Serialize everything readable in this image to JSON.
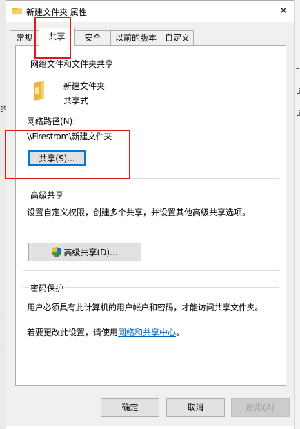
{
  "window": {
    "title": "新建文件夹 属性",
    "close_glyph": "✕"
  },
  "tabs": [
    {
      "label": "常规"
    },
    {
      "label": "共享",
      "active": true
    },
    {
      "label": "安全"
    },
    {
      "label": "以前的版本"
    },
    {
      "label": "自定义"
    }
  ],
  "network_share": {
    "group_title": "网络文件和文件夹共享",
    "folder_name": "新建文件夹",
    "share_state": "共享式",
    "path_label": "网络路径(N):",
    "path_value": "\\\\Firestrom\\新建文件夹",
    "share_button": "共享(S)..."
  },
  "advanced_share": {
    "group_title": "高级共享",
    "description": "设置自定义权限，创建多个共享，并设置其他高级共享选项。",
    "button": "高级共享(D)..."
  },
  "password": {
    "group_title": "密码保护",
    "description": "用户必须具有此计算机的用户帐户和密码，才能访问共享文件夹。",
    "change_prefix": "若要更改此设置，请使用",
    "link_text": "网络和共享中心",
    "change_suffix": "。"
  },
  "footer": {
    "ok": "确定",
    "cancel": "取消",
    "apply": "应用(A)"
  },
  "background": {
    "left_glyphs": [
      "的",
      "i",
      "i"
    ],
    "right_glyphs": [
      "t",
      "ti",
      "ti"
    ]
  },
  "colors": {
    "annotation_red": "#e01a1a",
    "link_blue": "#0066cc",
    "focus_blue": "#0078d7"
  }
}
